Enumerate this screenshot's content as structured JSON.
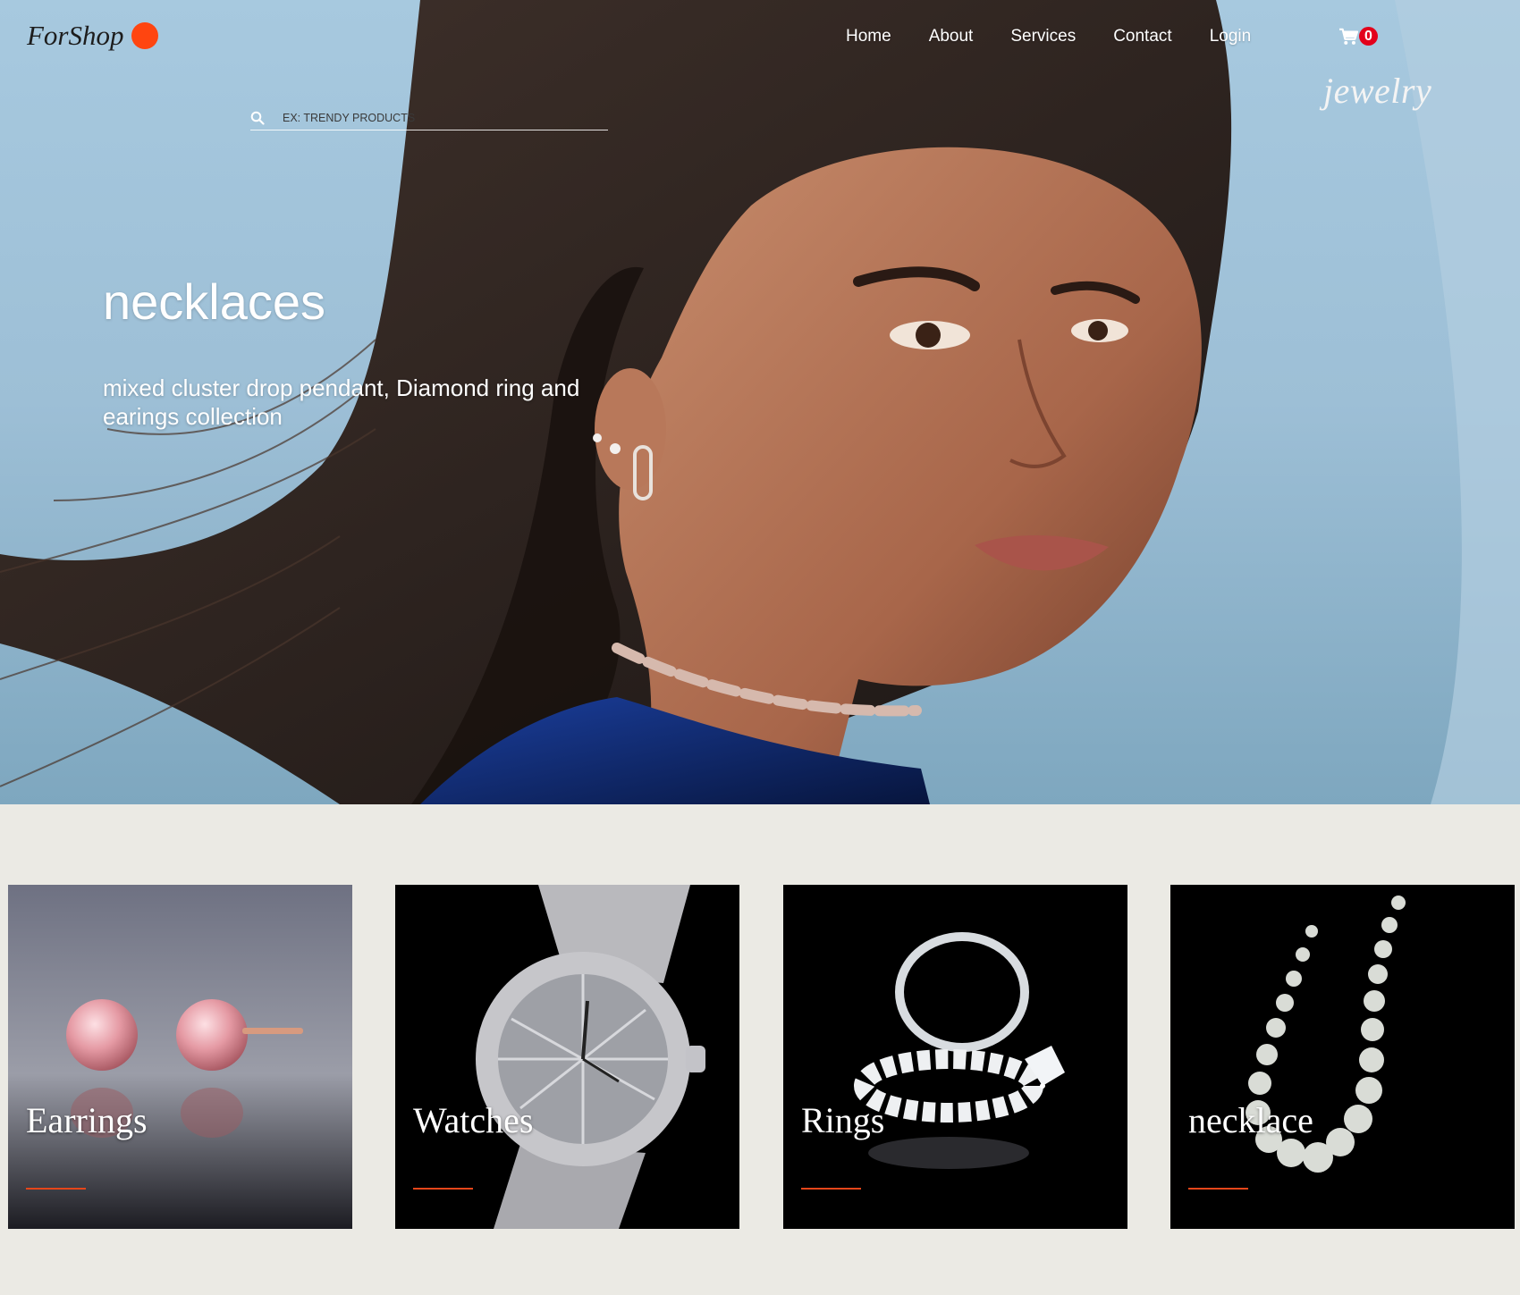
{
  "brand": {
    "name": "ForShop",
    "accent": "#ff4510"
  },
  "nav": {
    "items": [
      {
        "id": "home",
        "label": "Home"
      },
      {
        "id": "about",
        "label": "About"
      },
      {
        "id": "services",
        "label": "Services"
      },
      {
        "id": "contact",
        "label": "Contact"
      },
      {
        "id": "login",
        "label": "Login"
      }
    ],
    "cart_count": "0",
    "cart_icon": "shopping-cart-icon"
  },
  "tagline": "jewelry",
  "search": {
    "placeholder": "EX: TRENDY PRODUCTS",
    "value": "",
    "icon": "search-icon"
  },
  "hero": {
    "title": "necklaces",
    "subtitle": "mixed cluster drop pendant, Diamond ring and earings collection"
  },
  "categories": [
    {
      "label": "Earrings"
    },
    {
      "label": "Watches"
    },
    {
      "label": "Rings"
    },
    {
      "label": "necklace"
    }
  ],
  "colors": {
    "page_background": "#ebeae4",
    "underline": "#e4461a",
    "cart_badge": "#e3001b"
  }
}
